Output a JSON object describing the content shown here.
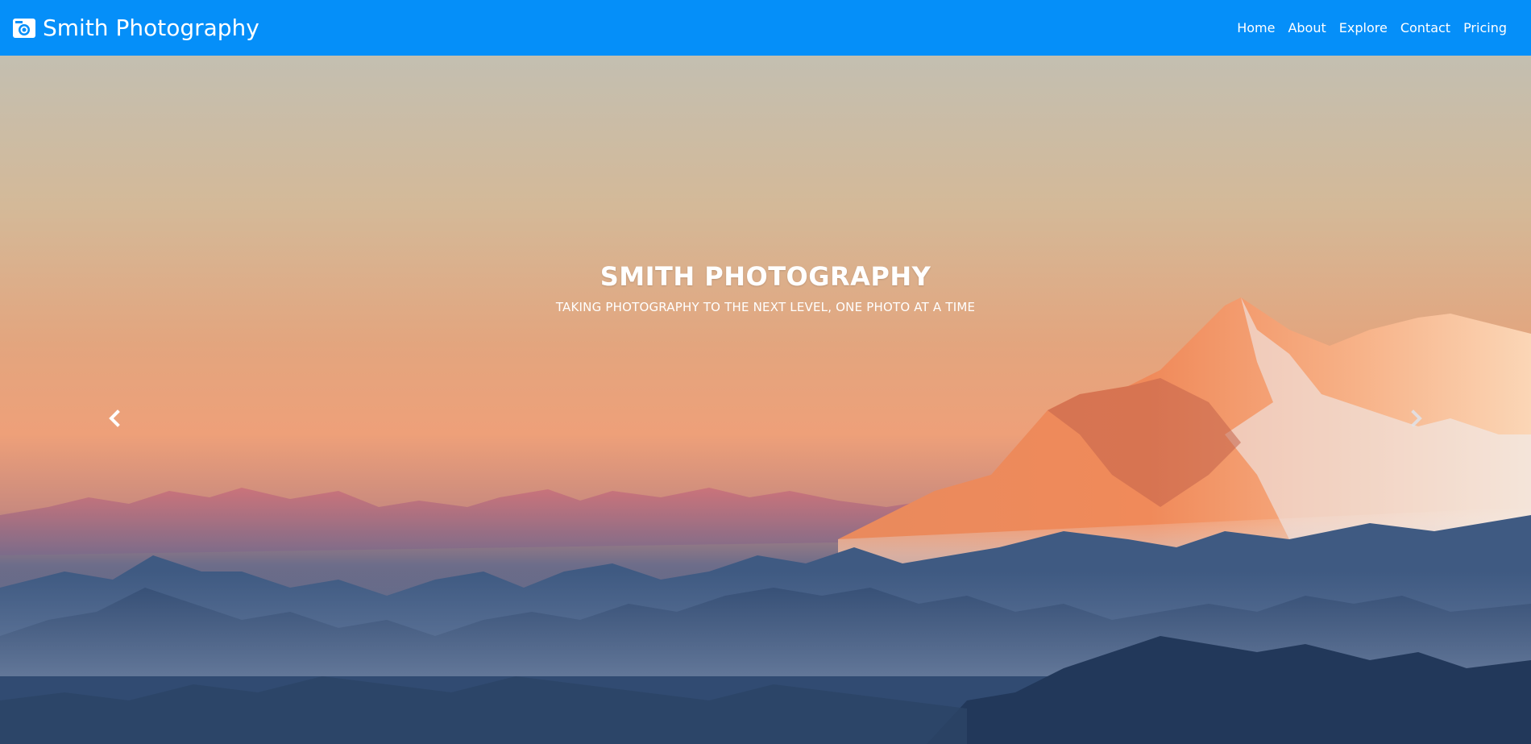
{
  "brand": {
    "name": "Smith Photography",
    "icon": "camera-icon"
  },
  "nav": {
    "items": [
      {
        "label": "Home"
      },
      {
        "label": "About"
      },
      {
        "label": "Explore"
      },
      {
        "label": "Contact"
      },
      {
        "label": "Pricing"
      }
    ]
  },
  "hero": {
    "title": "SMITH PHOTOGRAPHY",
    "subtitle": "TAKING PHOTOGRAPHY TO THE NEXT LEVEL, ONE PHOTO AT A TIME",
    "prev_icon": "chevron-left-icon",
    "next_icon": "chevron-right-icon"
  },
  "colors": {
    "navbar": "#058ff9",
    "text": "#ffffff",
    "sky_top": "#c3bfb1",
    "sky_mid": "#e3a57e",
    "peak_glow": "#f0875a",
    "valley": "#2f4a70"
  }
}
